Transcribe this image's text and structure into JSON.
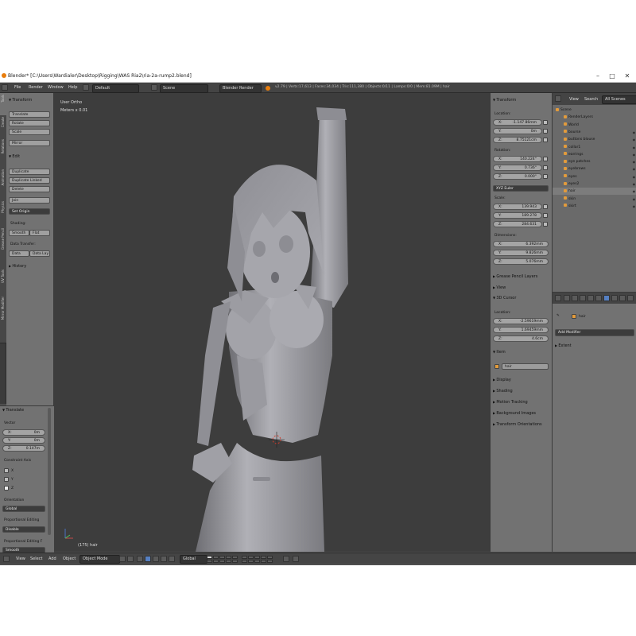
{
  "window": {
    "title": "Blender* [C:\\Users\\Wardialer\\Desktop\\Rigging\\WAS Ria2\\ria-2a-rump2.blend]",
    "minimize": "–",
    "maximize": "□",
    "close": "✕"
  },
  "info_header": {
    "menus": [
      "File",
      "Render",
      "Window",
      "Help"
    ],
    "layout": "Default",
    "scene": "Scene",
    "engine": "Blender Render",
    "stats": "v2.79 | Verts:17,613 | Faces:34,034 | Tris:111,380 | Objects:0/11 | Lamps:0/0 | Mem:81.09M | hair"
  },
  "left_tabs": [
    "Tools",
    "Create",
    "Relations",
    "Animation",
    "Physics",
    "Grease Pencil",
    "UV Tools",
    "Mirror Modifier"
  ],
  "tool_shelf": {
    "transform_header": "Transform",
    "transform_buttons": [
      "Translate",
      "Rotate",
      "Scale",
      "Mirror"
    ],
    "edit_header": "Edit",
    "edit_buttons": [
      "Duplicate",
      "Duplicate Linked",
      "Delete",
      "Join"
    ],
    "set_origin": "Set Origin",
    "shading_label": "Shading:",
    "smooth": "Smooth",
    "flat": "Flat",
    "data_transfer_label": "Data Transfer:",
    "data": "Data",
    "data_layout": "Data Lay",
    "history_header": "History"
  },
  "operator": {
    "header": "Translate",
    "vector_label": "Vector",
    "vector": [
      {
        "axis": "X:",
        "value": "0m"
      },
      {
        "axis": "Y:",
        "value": "0m"
      },
      {
        "axis": "Z:",
        "value": "0.147m"
      }
    ],
    "constraint_label": "Constraint Axis",
    "constraint_axes": [
      "X",
      "Y",
      "Z"
    ],
    "orientation_label": "Orientation",
    "orientation": "Global",
    "proportional_label": "Proportional Editing",
    "proportional": "Disable",
    "proportional_falloff_label": "Proportional Editing F",
    "proportional_falloff": "Smooth"
  },
  "viewport": {
    "view_name": "User Ortho",
    "units": "Meters x 0.01",
    "object_label": "(175) hair"
  },
  "n_panel": {
    "transform_header": "Transform",
    "location_label": "Location:",
    "location": [
      {
        "axis": "X:",
        "value": "-1.147 86mm"
      },
      {
        "axis": "Y:",
        "value": "0m"
      },
      {
        "axis": "Z:",
        "value": "8.75121cm"
      }
    ],
    "rotation_label": "Rotation:",
    "rotation": [
      {
        "axis": "X:",
        "value": "140.224°"
      },
      {
        "axis": "Y:",
        "value": "0.736°"
      },
      {
        "axis": "Z:",
        "value": "0.000°"
      }
    ],
    "rotation_mode": "XYZ Euler",
    "scale_label": "Scale:",
    "scale": [
      {
        "axis": "X:",
        "value": "139.943"
      },
      {
        "axis": "Y:",
        "value": "189.278"
      },
      {
        "axis": "Z:",
        "value": "284.631"
      }
    ],
    "dimensions_label": "Dimensions:",
    "dimensions": [
      {
        "axis": "X:",
        "value": "6.392mm"
      },
      {
        "axis": "Y:",
        "value": "9.826mm"
      },
      {
        "axis": "Z:",
        "value": "5.076mm"
      }
    ],
    "grease_pencil": "Grease Pencil Layers",
    "view": "View",
    "cursor_header": "3D Cursor",
    "cursor_location_label": "Location:",
    "cursor_location": [
      {
        "axis": "X:",
        "value": "-2.59619mm"
      },
      {
        "axis": "Y:",
        "value": "1.69459mm"
      },
      {
        "axis": "Z:",
        "value": "4.6cm"
      }
    ],
    "item_header": "Item",
    "item_name": "hair",
    "collapsed_panels": [
      "Display",
      "Shading",
      "Motion Tracking",
      "Background Images",
      "Transform Orientations"
    ]
  },
  "outliner": {
    "menu_view": "View",
    "menu_search": "Search",
    "scene_filter": "All Scenes",
    "rows": [
      {
        "name": "Scene",
        "indent": 0
      },
      {
        "name": "RenderLayers",
        "indent": 1
      },
      {
        "name": "World",
        "indent": 1
      },
      {
        "name": "bourse",
        "indent": 1
      },
      {
        "name": "buttons blouse",
        "indent": 1
      },
      {
        "name": "collar1",
        "indent": 1
      },
      {
        "name": "earrings",
        "indent": 1
      },
      {
        "name": "eye patches",
        "indent": 1
      },
      {
        "name": "eyebrows",
        "indent": 1
      },
      {
        "name": "eyes",
        "indent": 1
      },
      {
        "name": "eyes2",
        "indent": 1
      },
      {
        "name": "hair",
        "indent": 1
      },
      {
        "name": "skin",
        "indent": 1
      },
      {
        "name": "skirt",
        "indent": 1
      }
    ]
  },
  "properties": {
    "object_name": "hair",
    "add_modifier": "Add Modifier",
    "extent": "Extent"
  },
  "footer": {
    "menus": [
      "View",
      "Select",
      "Add",
      "Object"
    ],
    "mode": "Object Mode",
    "orientation": "Global"
  },
  "colors": {
    "viewport_bg": "#3d3d3d",
    "panel_bg": "#727272",
    "header_bg": "#444444",
    "accent_orange": "#e87d0d",
    "selected_blue": "#5680c2"
  }
}
